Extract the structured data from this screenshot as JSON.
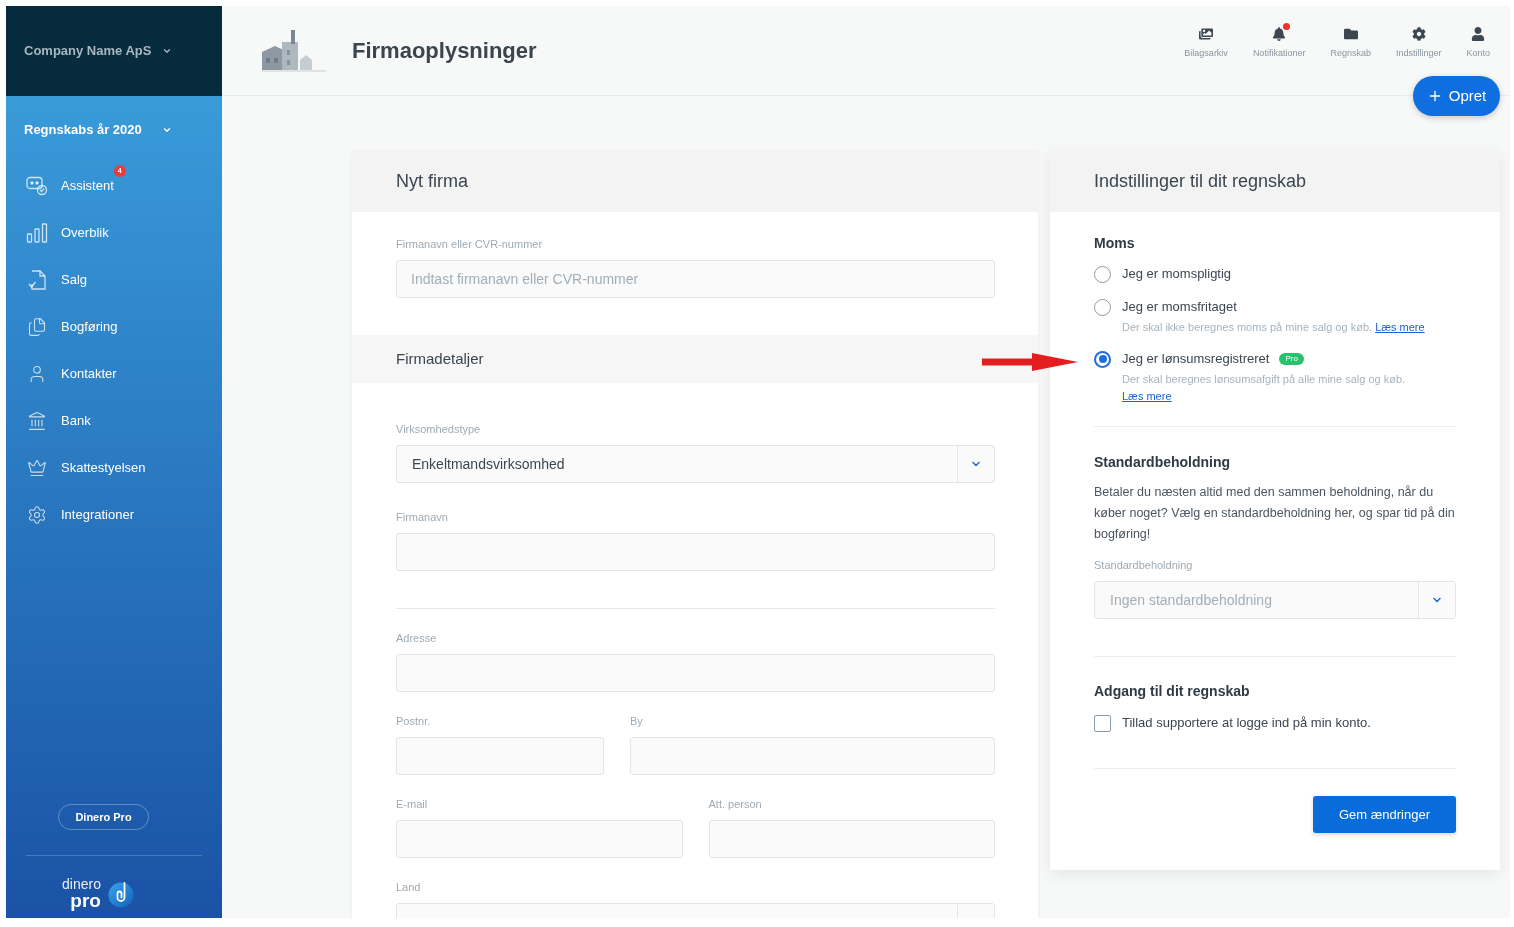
{
  "sidebar": {
    "company_selector": {
      "label": "Company Name ApS"
    },
    "fiscal_year_selector": {
      "label": "Regnskabs år 2020"
    },
    "items": [
      {
        "label": "Assistent",
        "badge": "4"
      },
      {
        "label": "Overblik"
      },
      {
        "label": "Salg"
      },
      {
        "label": "Bogføring"
      },
      {
        "label": "Kontakter"
      },
      {
        "label": "Bank"
      },
      {
        "label": "Skattestyelsen"
      },
      {
        "label": "Integrationer"
      }
    ],
    "pro_button": {
      "label": "Dinero Pro"
    },
    "logo": {
      "line_1": "dinero",
      "line_2": "pro"
    }
  },
  "header": {
    "title": "Firmaoplysninger",
    "actions": [
      {
        "label": "Bilagsarkiv",
        "unread": false
      },
      {
        "label": "Notifikationer",
        "unread": true
      },
      {
        "label": "Regnskab",
        "unread": false
      },
      {
        "label": "Indstillinger",
        "unread": false
      },
      {
        "label": "Konto",
        "unread": false
      }
    ],
    "create_button": {
      "label": "Opret"
    }
  },
  "company_card": {
    "title": "Nyt firma",
    "lookup_field": {
      "kind": "text",
      "label": "Firmanavn eller CVR-nummer",
      "placeholder": "Indtast firmanavn eller CVR-nummer"
    },
    "details": {
      "title": "Firmadetaljer",
      "sections": [
        {
          "rows": [
            {
              "fields": [
                {
                  "kind": "select",
                  "label": "Virksomhedstype",
                  "value": "Enkeltmandsvirksomhed"
                }
              ]
            },
            {
              "fields": [
                {
                  "kind": "text",
                  "label": "Firmanavn"
                }
              ]
            }
          ]
        },
        {
          "rows": [
            {
              "fields": [
                {
                  "kind": "text",
                  "label": "Adresse"
                }
              ]
            },
            {
              "fields": [
                {
                  "kind": "short_text",
                  "label": "Postnr."
                },
                {
                  "kind": "text",
                  "label": "By"
                }
              ]
            },
            {
              "fields": [
                {
                  "kind": "text",
                  "label": "E-mail"
                },
                {
                  "kind": "text",
                  "label": "Att. person"
                }
              ]
            },
            {
              "fields": [
                {
                  "kind": "select",
                  "label": "Land"
                }
              ]
            }
          ]
        }
      ]
    }
  },
  "settings_card": {
    "title": "Indstillinger til dit regnskab",
    "vat": {
      "title": "Moms",
      "options": [
        {
          "label": "Jeg er momspligtig",
          "selected": false
        },
        {
          "label": "Jeg er momsfritaget",
          "selected": false,
          "description": "Der skal ikke beregnes moms på mine salg og køb.",
          "link": "Læs mere"
        },
        {
          "label": "Jeg er lønsumsregistreret",
          "selected": true,
          "badge": "Pro",
          "description": "Der skal beregnes lønsumsafgift på alle mine salg og køb.",
          "link": "Læs mere"
        }
      ]
    },
    "default_holding": {
      "title": "Standardbeholdning",
      "text": "Betaler du næsten altid med den sammen beholdning, når du køber noget? Vælg en standardbeholdning her, og spar tid på din bogføring!",
      "field": {
        "kind": "select",
        "label": "Standardbeholdning",
        "placeholder": "Ingen standardbeholdning"
      }
    },
    "access": {
      "title": "Adgang til dit regnskab",
      "checkbox": {
        "label": "Tillad supportere at logge ind på min konto.",
        "checked": false
      }
    },
    "save_button": {
      "label": "Gem ændringer"
    }
  }
}
